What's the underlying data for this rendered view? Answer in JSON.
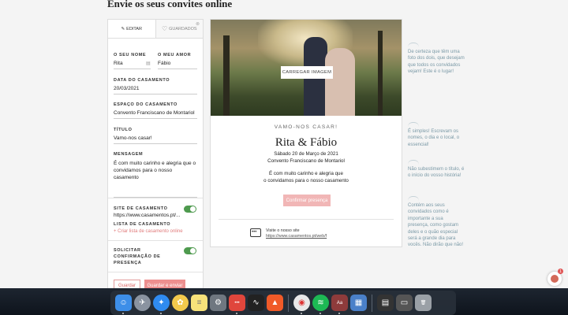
{
  "page": {
    "title": "Envie os seus convites online"
  },
  "editor": {
    "tabs": [
      {
        "label": "EDITAR"
      },
      {
        "label": "GUARDADOS"
      }
    ],
    "fields": {
      "your_name": {
        "label": "O SEU NOME",
        "value": "Rita"
      },
      "partner_name": {
        "label": "O MEU AMOR",
        "value": "Fábio"
      },
      "date": {
        "label": "DATA DO CASAMENTO",
        "value": "20/03/2021"
      },
      "venue": {
        "label": "ESPAÇO DO CASAMENTO",
        "value": "Convento Franciscano de Montariol"
      },
      "title": {
        "label": "TÍTULO",
        "value": "Vamo-nos casar!"
      },
      "message": {
        "label": "MENSAGEM",
        "value": "É com muito carinho e alegria que o convidamos para o nosso casamento"
      }
    },
    "site": {
      "label": "SITE DE CASAMENTO",
      "value": "https://www.casamentos.pt/...",
      "enabled": true
    },
    "list": {
      "label": "LISTA DE CASAMENTO",
      "link": "+ Criar lista de casamento online"
    },
    "rsvp": {
      "label_line1": "SOLICITAR",
      "label_line2": "CONFIRMAÇÃO DE",
      "label_line3": "PRESENÇA",
      "enabled": true
    },
    "buttons": {
      "save": "Guardar",
      "save_send": "Guardar e enviar"
    }
  },
  "preview": {
    "upload_label": "CARREGAR IMAGEM",
    "subtitle": "VAMO-NOS CASAR!",
    "names": "Rita & Fábio",
    "date_line": "Sábado 20 de Março de 2021",
    "venue": "Convento Franciscano de Montariol",
    "message_line1": "É com muito carinho e alegria que",
    "message_line2": "o convidamos para o nosso casamento",
    "confirm_label": "Confirmar presença",
    "visit_label": "Visite o nosso site",
    "visit_url": "https://www.casamentos.pt/web/f"
  },
  "tips": [
    {
      "text": "De certeza que têm uma foto dos dois, que desejam que todos os convidados vejam! Este é o lugar!"
    },
    {
      "text": "É simples! Escrevam os nomes, o dia e o local, o essencial!"
    },
    {
      "text": "Não subestimem o título, é o início do vosso história!"
    },
    {
      "text": "Contém aos seus convidados como é importante a sua presença, como gostam deles e o quão especial será a grande dia para vocês. Não dirão que não!"
    }
  ],
  "chat": {
    "badge": "1"
  },
  "dock": {
    "apps": [
      {
        "name": "finder-icon",
        "color": "#3d8ee8",
        "glyph": "☺"
      },
      {
        "name": "launchpad-icon",
        "color": "#8a93a0",
        "glyph": "✈"
      },
      {
        "name": "safari-icon",
        "color": "#2f8bf0",
        "glyph": "✦"
      },
      {
        "name": "photos-icon",
        "color": "#f2c94c",
        "glyph": "✿"
      },
      {
        "name": "notes-icon",
        "color": "#f7e27a",
        "glyph": "≡"
      },
      {
        "name": "system-preferences-icon",
        "color": "#6f7780",
        "glyph": "⚙"
      },
      {
        "name": "dots-app-icon",
        "color": "#e0463c",
        "glyph": "•••"
      },
      {
        "name": "activity-monitor-icon",
        "color": "#222",
        "glyph": "∿"
      },
      {
        "name": "brave-icon",
        "color": "#f05a28",
        "glyph": "▲"
      },
      {
        "name": "chrome-icon",
        "color": "#e8e8e8",
        "glyph": "◉"
      },
      {
        "name": "spotify-icon",
        "color": "#1db954",
        "glyph": "≋"
      },
      {
        "name": "dictionary-icon",
        "color": "#8e3b3b",
        "glyph": "Aa"
      },
      {
        "name": "preview-icon",
        "color": "#4a80c9",
        "glyph": "▦"
      },
      {
        "name": "downloads-stack-icon",
        "color": "#333",
        "glyph": "▤"
      },
      {
        "name": "screenshot-icon",
        "color": "#555",
        "glyph": "▭"
      },
      {
        "name": "trash-icon",
        "color": "#9aa0a6",
        "glyph": "🗑"
      }
    ]
  }
}
